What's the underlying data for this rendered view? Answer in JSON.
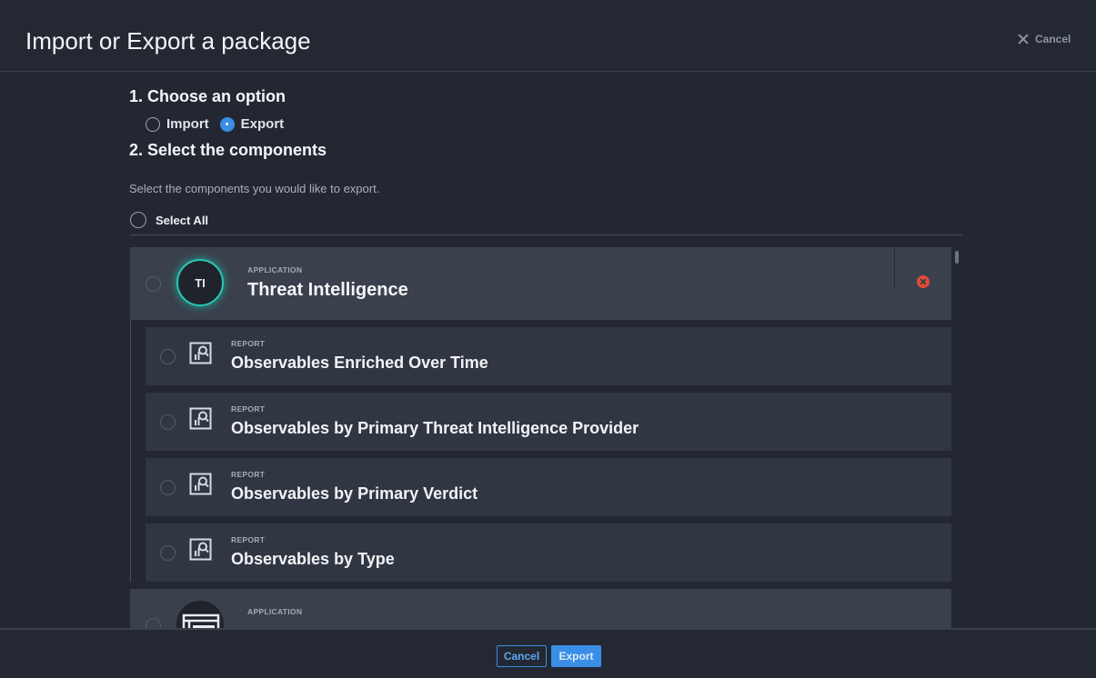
{
  "header": {
    "title": "Import or Export a package",
    "cancel_label": "Cancel"
  },
  "step1": {
    "title": "1. Choose an option",
    "options": [
      {
        "label": "Import",
        "selected": false
      },
      {
        "label": "Export",
        "selected": true
      }
    ]
  },
  "step2": {
    "title": "2. Select the components",
    "description": "Select the components you would like to export.",
    "select_all_label": "Select All"
  },
  "components": {
    "app1": {
      "type": "APPLICATION",
      "name": "Threat Intelligence",
      "initials": "TI",
      "avatar_ring_color": "#29c7b3"
    },
    "reports": [
      {
        "type": "REPORT",
        "name": "Observables Enriched Over Time"
      },
      {
        "type": "REPORT",
        "name": "Observables by Primary Threat Intelligence Provider"
      },
      {
        "type": "REPORT",
        "name": "Observables by Primary Verdict"
      },
      {
        "type": "REPORT",
        "name": "Observables by Type"
      }
    ],
    "app2": {
      "type": "APPLICATION"
    }
  },
  "footer": {
    "cancel_label": "Cancel",
    "export_label": "Export"
  },
  "colors": {
    "accent": "#3a8ee6",
    "remove": "#e24b34",
    "background": "#232732"
  }
}
